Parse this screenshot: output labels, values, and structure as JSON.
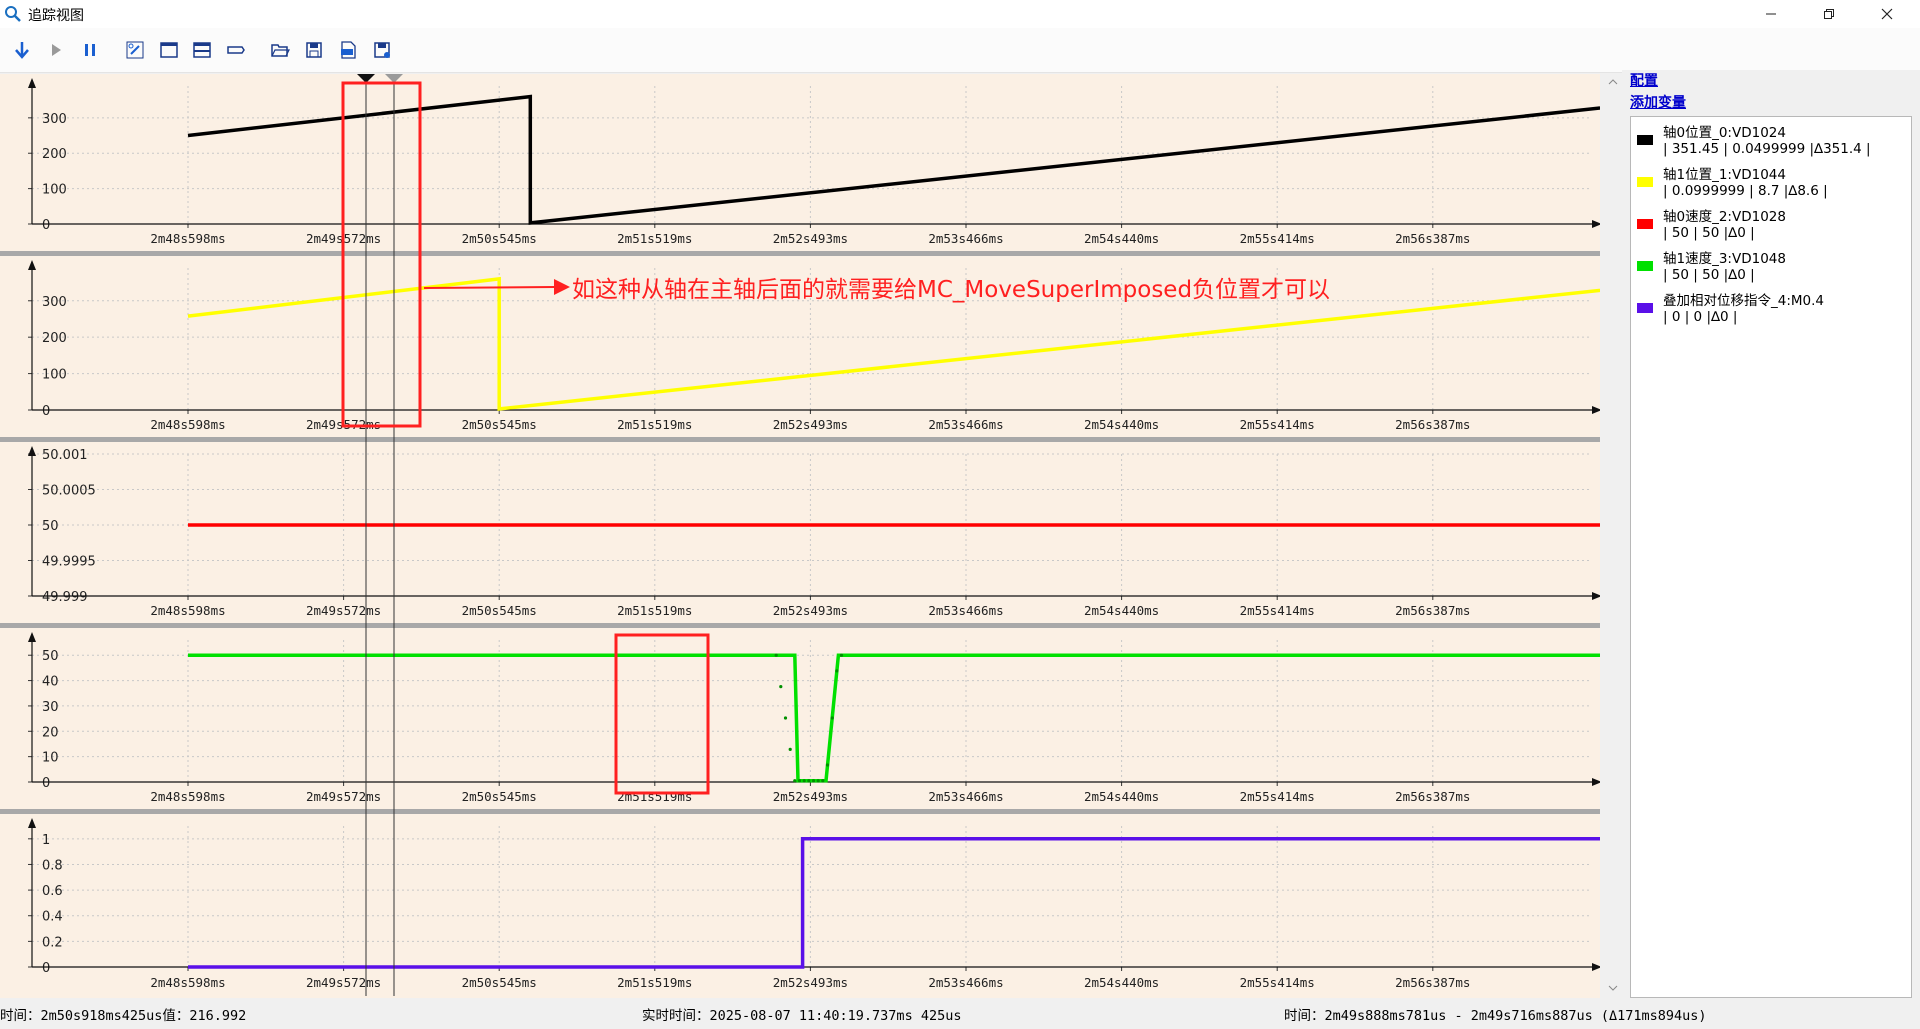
{
  "window": {
    "title": "追踪视图",
    "icon": "magnifier-icon",
    "controls": [
      "minimize-icon",
      "maximize-icon",
      "close-icon"
    ]
  },
  "toolbar": {
    "buttons": [
      {
        "name": "download-icon",
        "color": "#1a5fd0"
      },
      {
        "name": "play-icon",
        "color": "#9a9a9a"
      },
      {
        "name": "pause-icon",
        "color": "#1a5fd0"
      },
      {
        "name": "link-icon",
        "color": "#1a5fd0"
      },
      {
        "name": "single-view-icon",
        "color": "#1a3a8a"
      },
      {
        "name": "split-view-icon",
        "color": "#1a3a8a"
      },
      {
        "name": "tag-icon",
        "color": "#1a3a8a"
      },
      {
        "name": "open-folder-icon",
        "color": "#1a3a8a"
      },
      {
        "name": "save-icon",
        "color": "#1a3a8a"
      },
      {
        "name": "export-csv-icon",
        "color": "#1a3a8a"
      },
      {
        "name": "save-as-icon",
        "color": "#1a3a8a"
      }
    ]
  },
  "sidebar": {
    "config_label": "配置",
    "add_variable_label": "添加变量",
    "legend": [
      {
        "name": "轴0位置_0:VD1024",
        "values": "| 351.45 | 0.0499999 |∆351.4 |",
        "color": "#000000"
      },
      {
        "name": "轴1位置_1:VD1044",
        "values": "| 0.0999999 | 8.7 |∆8.6 |",
        "color": "#ffff00"
      },
      {
        "name": "轴0速度_2:VD1028",
        "values": "| 50 | 50 |∆0 |",
        "color": "#ff0000"
      },
      {
        "name": "轴1速度_3:VD1048",
        "values": "| 50 | 50 |∆0 |",
        "color": "#00e000"
      },
      {
        "name": "叠加相对位移指令_4:M0.4",
        "values": "| 0 | 0 |∆0 |",
        "color": "#5a10e8"
      }
    ]
  },
  "time_ticks": [
    "2m48s598ms",
    "2m49s572ms",
    "2m50s545ms",
    "2m51s519ms",
    "2m52s493ms",
    "2m53s466ms",
    "2m54s440ms",
    "2m55s414ms",
    "2m56s387ms"
  ],
  "chart_data": [
    {
      "type": "line",
      "series": [
        {
          "name": "轴0位置_0:VD1024",
          "color": "#000000",
          "x": [
            0,
            2.2,
            2.2,
            9.8,
            9.8,
            10.1
          ],
          "y": [
            250,
            360,
            3,
            362,
            3,
            12
          ]
        }
      ],
      "yticks": [
        "0",
        "100",
        "200",
        "300"
      ],
      "ylim": [
        0,
        390
      ]
    },
    {
      "type": "line",
      "series": [
        {
          "name": "轴1位置_1:VD1044",
          "color": "#ffff00",
          "x": [
            0,
            2.0,
            2.0,
            9.8,
            9.8,
            10.1
          ],
          "y": [
            258,
            360,
            3,
            362,
            3,
            12
          ]
        }
      ],
      "yticks": [
        "0",
        "100",
        "200",
        "300"
      ],
      "ylim": [
        0,
        390
      ]
    },
    {
      "type": "line",
      "series": [
        {
          "name": "轴0速度_2:VD1028",
          "color": "#ff0000",
          "x": [
            0,
            10.1
          ],
          "y": [
            50,
            50
          ]
        }
      ],
      "yticks": [
        "49.999",
        "49.9995",
        "50",
        "50.0005",
        "50.001"
      ],
      "ylim": [
        49.999,
        50.001
      ]
    },
    {
      "type": "line",
      "series": [
        {
          "name": "轴1速度_3:VD1048",
          "color": "#00e000",
          "x": [
            0,
            3.75,
            3.9,
            3.92,
            4.05,
            4.1,
            4.18,
            10.1
          ],
          "y": [
            50,
            50,
            50,
            0.5,
            0.5,
            0.5,
            50,
            50
          ]
        }
      ],
      "yticks": [
        "0",
        "10",
        "20",
        "30",
        "40",
        "50"
      ],
      "ylim": [
        0,
        56
      ]
    },
    {
      "type": "line",
      "series": [
        {
          "name": "叠加相对位移指令_4:M0.4",
          "color": "#5a10e8",
          "x": [
            0,
            3.95,
            3.95,
            10.1
          ],
          "y": [
            0,
            0,
            1,
            1
          ]
        }
      ],
      "yticks": [
        "0",
        "0.2",
        "0.4",
        "0.6",
        "0.8",
        "1"
      ],
      "ylim": [
        0,
        1.1
      ]
    }
  ],
  "annotation": {
    "text": "如这种从轴在主轴后面的就需要给MC_MoveSuperImposed负位置才可以",
    "color": "#ff2020"
  },
  "status": {
    "left": "时间：2m50s918ms425us值：216.992",
    "center": "实时时间：2025-08-07 11:40:19.737ms 425us",
    "right": "时间：2m49s888ms781us - 2m49s716ms887us (Δ171ms894us)"
  },
  "colors": {
    "plot_background": "#fbf0e4",
    "grid": "#c8c8c8",
    "separator": "#a8a8a8"
  }
}
